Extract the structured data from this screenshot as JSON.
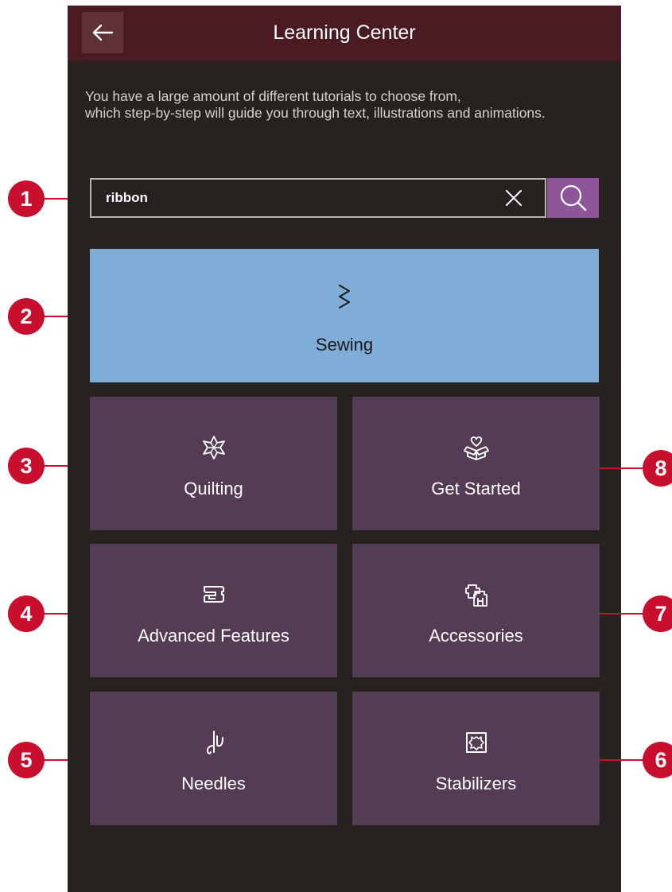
{
  "header": {
    "title": "Learning Center",
    "back_icon": "arrow-left-icon"
  },
  "intro": {
    "line1": "You have a large amount of different tutorials to choose from,",
    "line2": "which step-by-step will guide you through text, illustrations and animations."
  },
  "search": {
    "value": "ribbon",
    "clear_icon": "close-icon",
    "search_icon": "search-icon"
  },
  "tiles": [
    {
      "label": "Sewing",
      "icon": "zigzag-stitch-icon"
    },
    {
      "label": "Quilting",
      "icon": "quilt-star-icon"
    },
    {
      "label": "Get Started",
      "icon": "gift-heart-box-icon"
    },
    {
      "label": "Advanced Features",
      "icon": "sewing-machine-icon"
    },
    {
      "label": "Accessories",
      "icon": "presser-feet-icon"
    },
    {
      "label": "Needles",
      "icon": "needle-thread-icon"
    },
    {
      "label": "Stabilizers",
      "icon": "stabilizer-patch-icon"
    }
  ],
  "callouts": [
    "1",
    "2",
    "3",
    "4",
    "5",
    "6",
    "7",
    "8"
  ],
  "colors": {
    "titlebar": "#4a1b22",
    "background": "#262220",
    "sewing_tile": "#80add7",
    "category_tile": "#553c55",
    "search_button": "#8d5698",
    "callout": "#c8102e"
  }
}
